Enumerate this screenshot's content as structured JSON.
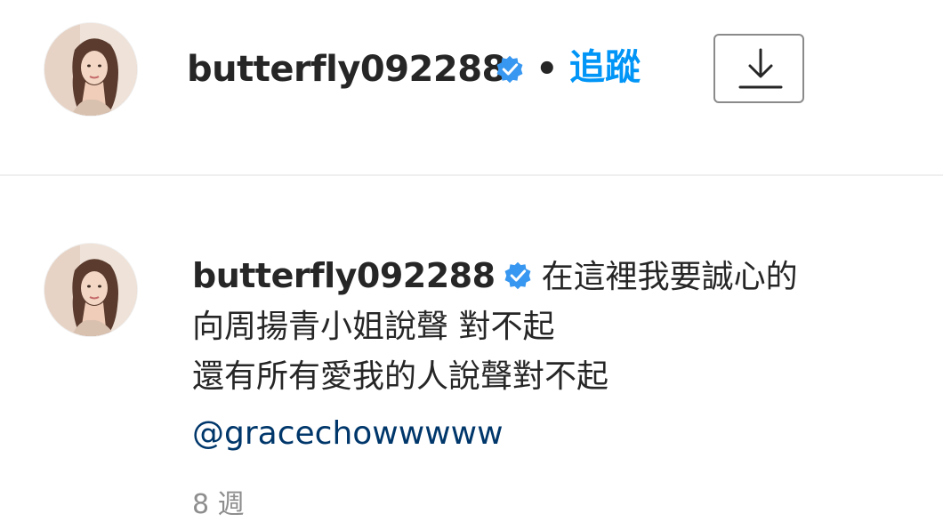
{
  "header": {
    "username": "butterfly092288",
    "separator": "•",
    "follow_label": "追蹤",
    "verified_icon": "verified-badge-icon",
    "download_icon": "download-icon"
  },
  "comment": {
    "username": "butterfly092288",
    "text_line_1": "在這裡我要誠心的",
    "text_line_2": "向周揚青小姐說聲 對不起",
    "text_line_3": "還有所有愛我的人說聲對不起",
    "mention": "@gracechowwwww",
    "timestamp": "8 週"
  },
  "colors": {
    "accent": "#0095f6",
    "mention": "#00376b",
    "muted": "#8e8e8e",
    "text": "#262626"
  }
}
